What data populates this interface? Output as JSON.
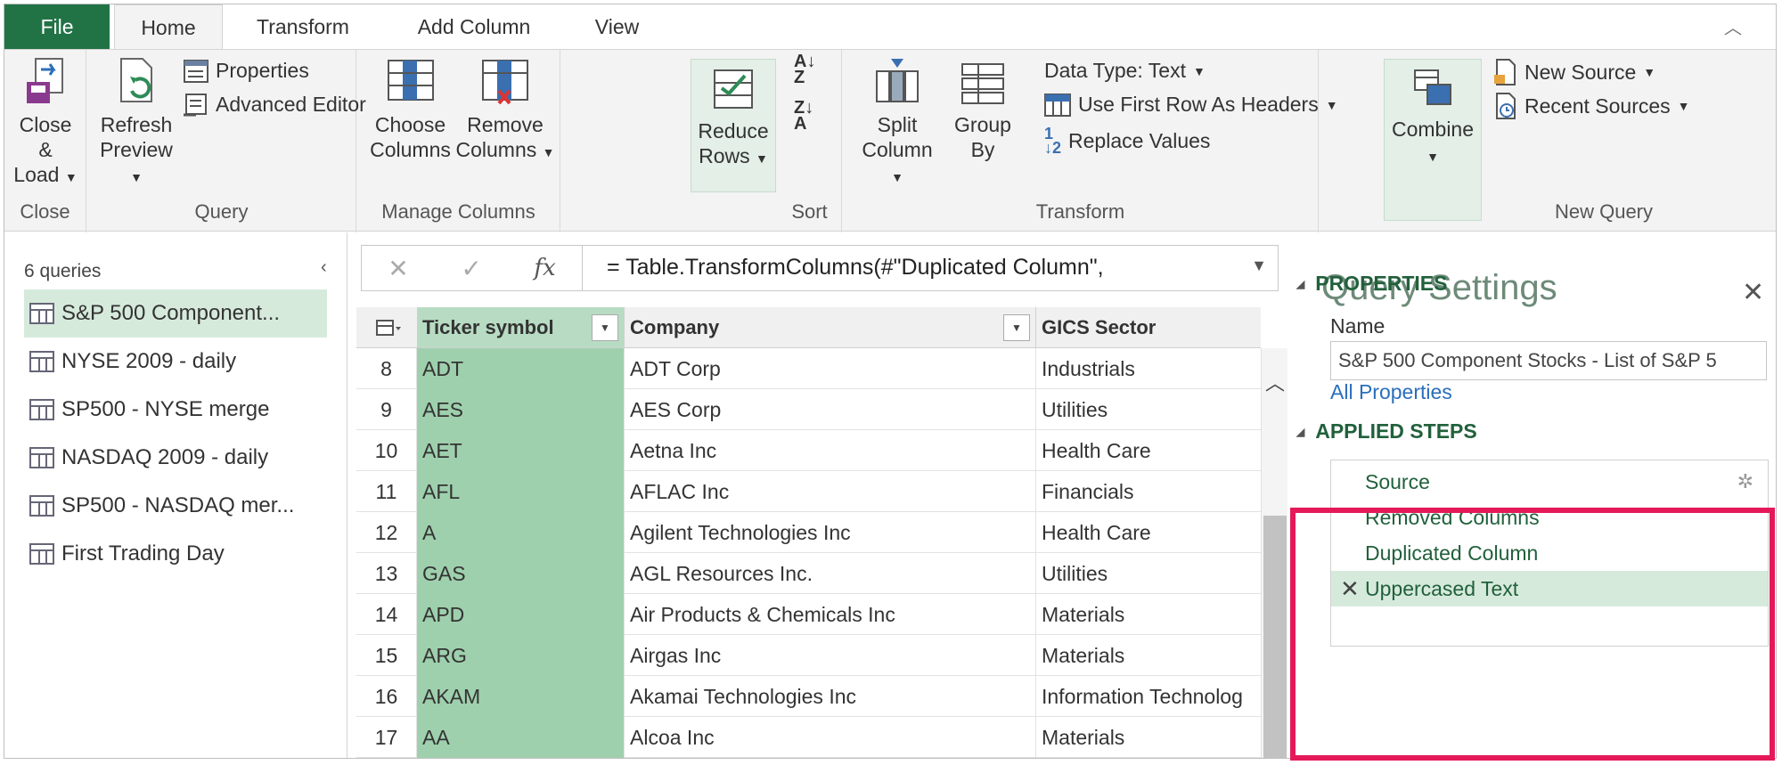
{
  "ribbon": {
    "tabs": [
      "File",
      "Home",
      "Transform",
      "Add Column",
      "View"
    ],
    "groups": {
      "close": {
        "label": "Close",
        "close_load": "Close &",
        "close_load2": "Load"
      },
      "query": {
        "label": "Query",
        "refresh": "Refresh",
        "refresh2": "Preview",
        "properties": "Properties",
        "advanced_editor": "Advanced Editor"
      },
      "manage_columns": {
        "label": "Manage Columns",
        "choose": "Choose",
        "choose2": "Columns",
        "remove": "Remove",
        "remove2": "Columns"
      },
      "reduce": {
        "reduce": "Reduce",
        "reduce2": "Rows"
      },
      "sort": {
        "label": "Sort"
      },
      "transform": {
        "label": "Transform",
        "split": "Split",
        "split2": "Column",
        "group": "Group",
        "group2": "By",
        "data_type": "Data Type: Text",
        "first_row": "Use First Row As Headers",
        "replace": "Replace Values"
      },
      "combine": {
        "combine": "Combine"
      },
      "new_query": {
        "label": "New Query",
        "new_source": "New Source",
        "recent_sources": "Recent Sources"
      }
    }
  },
  "queries": {
    "count": "6 queries",
    "items": [
      "S&P 500 Component...",
      "NYSE 2009 - daily",
      "SP500 - NYSE merge",
      "NASDAQ 2009 - daily",
      "SP500 - NASDAQ mer...",
      "First Trading Day"
    ]
  },
  "formula": "= Table.TransformColumns(#\"Duplicated Column\",",
  "grid": {
    "headers": [
      "Ticker symbol",
      "Company",
      "GICS Sector"
    ],
    "rows": [
      [
        "8",
        "ADT",
        "ADT Corp",
        "Industrials"
      ],
      [
        "9",
        "AES",
        "AES Corp",
        "Utilities"
      ],
      [
        "10",
        "AET",
        "Aetna Inc",
        "Health Care"
      ],
      [
        "11",
        "AFL",
        "AFLAC Inc",
        "Financials"
      ],
      [
        "12",
        "A",
        "Agilent Technologies Inc",
        "Health Care"
      ],
      [
        "13",
        "GAS",
        "AGL Resources Inc.",
        "Utilities"
      ],
      [
        "14",
        "APD",
        "Air Products & Chemicals Inc",
        "Materials"
      ],
      [
        "15",
        "ARG",
        "Airgas Inc",
        "Materials"
      ],
      [
        "16",
        "AKAM",
        "Akamai Technologies Inc",
        "Information Technolog"
      ],
      [
        "17",
        "AA",
        "Alcoa Inc",
        "Materials"
      ]
    ]
  },
  "settings": {
    "title": "Query Settings",
    "properties_head": "PROPERTIES",
    "name_label": "Name",
    "name_value": "S&P 500 Component Stocks - List of S&P 5",
    "all_properties": "All Properties",
    "steps_head": "APPLIED STEPS",
    "steps": [
      "Source",
      "Removed Columns",
      "Duplicated Column",
      "Uppercased Text"
    ]
  },
  "colors": {
    "file_tab": "#217346",
    "selected_column": "#9fd0ad",
    "highlight": "#e5195a"
  }
}
